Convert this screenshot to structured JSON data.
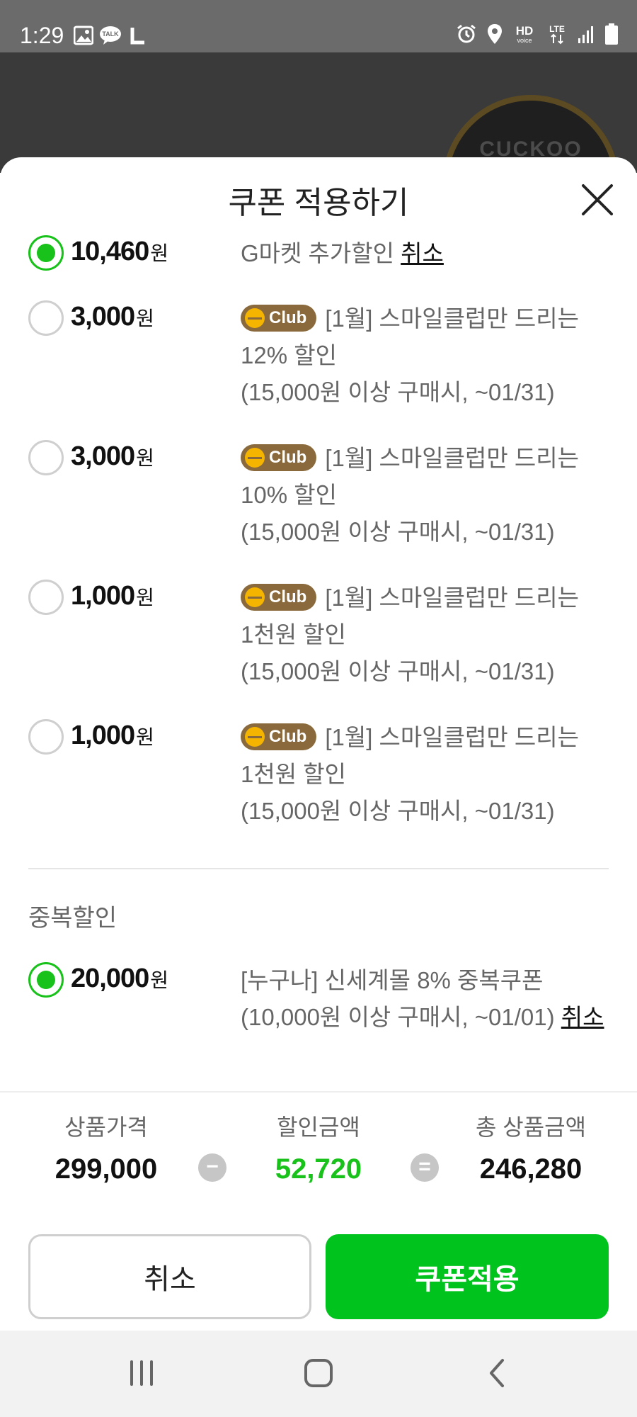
{
  "status_bar": {
    "time": "1:29",
    "left_icons": [
      "gallery-icon",
      "kakaotalk-icon",
      "l-icon"
    ],
    "talk_badge": "TALK",
    "hd_label": "HD",
    "voice_label": "voice",
    "lte_label": "LTE",
    "right_icons": [
      "alarm-icon",
      "location-icon",
      "hd-voice-icon",
      "lte-icon",
      "signal-icon",
      "battery-icon"
    ]
  },
  "background": {
    "brand_text": "CUCKOO"
  },
  "sheet": {
    "title": "쿠폰 적용하기",
    "close_icon": "close-icon"
  },
  "coupons": [
    {
      "amount": "10,460",
      "unit": "원",
      "checked": true,
      "club": false,
      "text": "G마켓 추가할인 ",
      "action": "취소",
      "line2": "",
      "line3": ""
    },
    {
      "amount": "3,000",
      "unit": "원",
      "checked": false,
      "club": true,
      "club_label": "Club",
      "text": "[1월] 스마일클럽만 드리는",
      "line2": "12% 할인",
      "line3": "(15,000원 이상 구매시, ~01/31)"
    },
    {
      "amount": "3,000",
      "unit": "원",
      "checked": false,
      "club": true,
      "club_label": "Club",
      "text": "[1월] 스마일클럽만 드리는",
      "line2": "10% 할인",
      "line3": "(15,000원 이상 구매시, ~01/31)"
    },
    {
      "amount": "1,000",
      "unit": "원",
      "checked": false,
      "club": true,
      "club_label": "Club",
      "text": "[1월] 스마일클럽만 드리는",
      "line2": "1천원 할인",
      "line3": "(15,000원 이상 구매시, ~01/31)"
    },
    {
      "amount": "1,000",
      "unit": "원",
      "checked": false,
      "club": true,
      "club_label": "Club",
      "text": "[1월] 스마일클럽만 드리는",
      "line2": "1천원 할인",
      "line3": "(15,000원 이상 구매시, ~01/31)"
    }
  ],
  "duplicate_section": {
    "label": "중복할인",
    "coupon": {
      "amount": "20,000",
      "unit": "원",
      "checked": true,
      "line1": "[누구나] 신세계몰 8% 중복쿠폰",
      "line2": "(10,000원 이상 구매시, ~01/01) ",
      "action": "취소"
    }
  },
  "summary": {
    "price_label": "상품가격",
    "price_value": "299,000",
    "discount_label": "할인금액",
    "discount_value": "52,720",
    "total_label": "총 상품금액",
    "total_value": "246,280",
    "minus_symbol": "−",
    "equals_symbol": "="
  },
  "buttons": {
    "cancel": "취소",
    "apply": "쿠폰적용"
  },
  "colors": {
    "accent_green": "#18c21a",
    "apply_button": "#00c31e",
    "club_badge": "#8a6a3c"
  },
  "nav": {
    "icons": [
      "recent-apps-icon",
      "home-icon",
      "back-icon"
    ]
  }
}
